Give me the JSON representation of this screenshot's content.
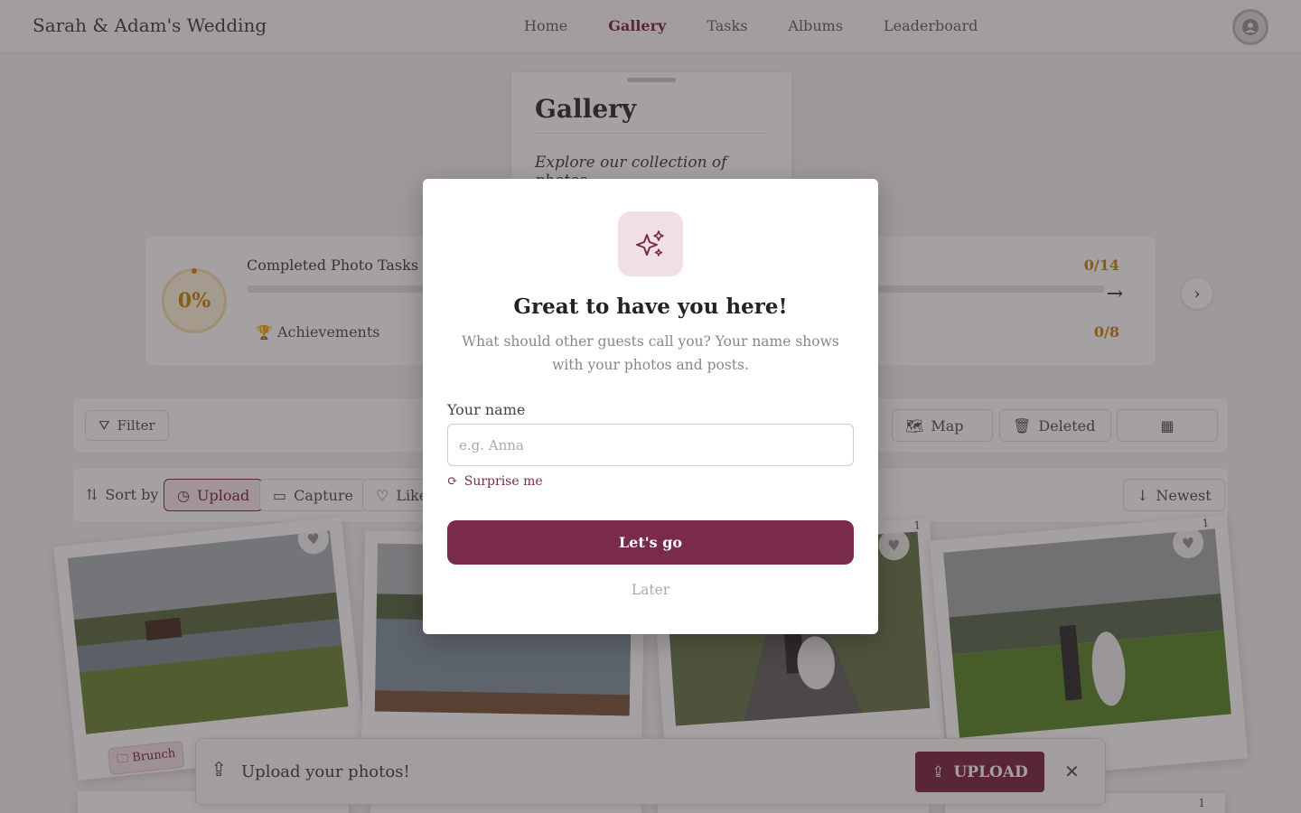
{
  "header": {
    "brand": "Sarah & Adam's Wedding",
    "nav": [
      "Home",
      "Gallery",
      "Tasks",
      "Albums",
      "Leaderboard"
    ],
    "active_nav": "Gallery",
    "avatar_icon": "user-avatar-icon"
  },
  "title_card": {
    "title": "Gallery",
    "subtitle": "Explore our collection of photos"
  },
  "progress": {
    "percent": "0%",
    "tasks_label": "Completed Photo Tasks",
    "tasks_count": "0/14",
    "achievements_label": "Achievements",
    "achievements_count": "0/8"
  },
  "toolbar": {
    "filter": "Filter",
    "map": "Map",
    "deleted": "Deleted"
  },
  "sortbar": {
    "sort_by": "Sort by",
    "upload": "Upload",
    "capture": "Capture",
    "likes": "Likes",
    "newest": "Newest"
  },
  "photos": {
    "tag_brunch": "Brunch",
    "like_count_3": "1",
    "like_count_4": "1",
    "like_count_row2": "1"
  },
  "upload_bar": {
    "text": "Upload your photos!",
    "button": "UPLOAD"
  },
  "modal": {
    "title": "Great to have you here!",
    "subtitle": "What should other guests call you? Your name shows with your photos and posts.",
    "name_label": "Your name",
    "name_placeholder": "e.g. Anna",
    "name_value": "",
    "surprise": "Surprise me",
    "primary": "Let's go",
    "secondary": "Later"
  },
  "colors": {
    "accent": "#7a2a4a",
    "accent_light": "#f1dfe6",
    "gold": "#c88a10"
  }
}
